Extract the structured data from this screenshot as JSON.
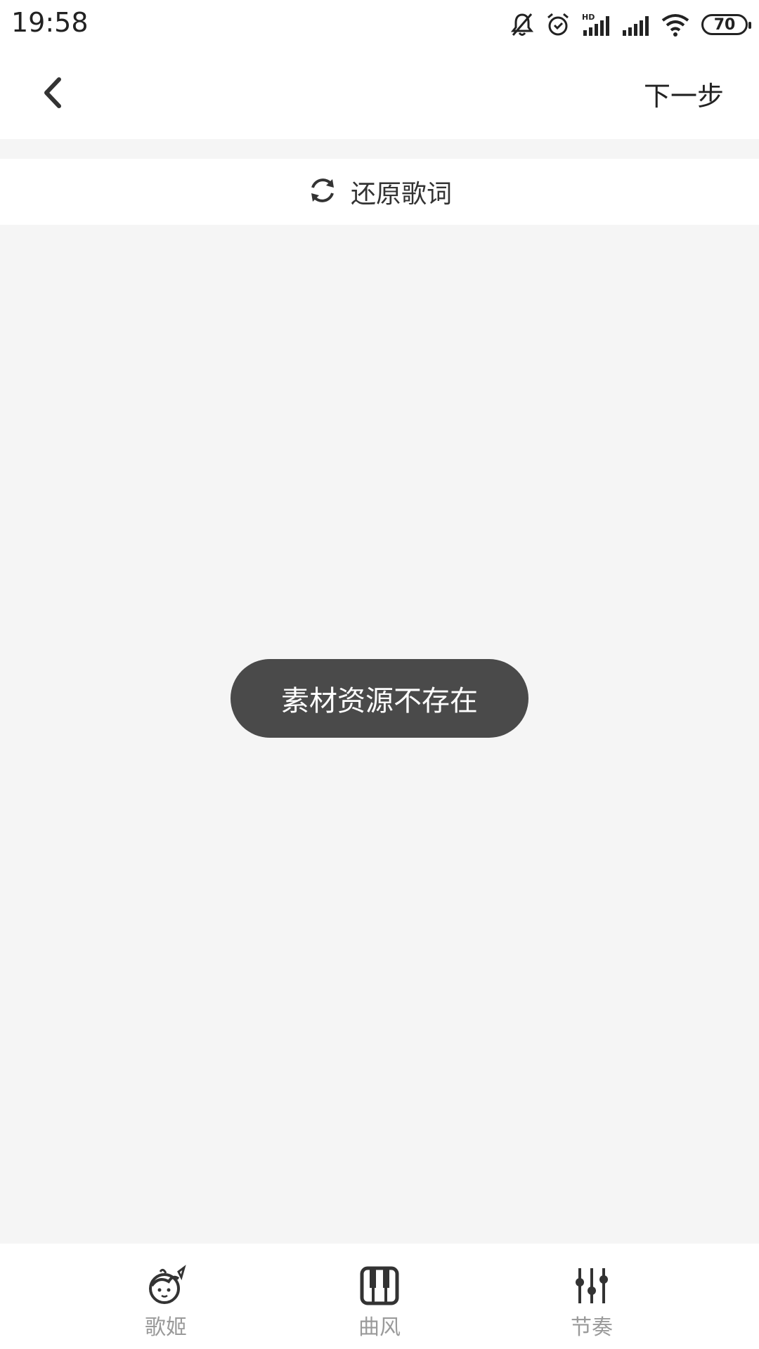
{
  "status_bar": {
    "time": "19:58",
    "battery": "70",
    "icons": [
      "bell-off-icon",
      "alarm-icon",
      "hd-signal-icon",
      "signal-icon",
      "wifi-icon",
      "battery-icon"
    ]
  },
  "nav": {
    "back_icon": "chevron-left-icon",
    "next_label": "下一步"
  },
  "restore": {
    "icon": "refresh-icon",
    "label": "还原歌词"
  },
  "toast": {
    "message": "素材资源不存在"
  },
  "tabs": [
    {
      "label": "歌姬",
      "icon": "singer-avatar-icon"
    },
    {
      "label": "曲风",
      "icon": "piano-icon"
    },
    {
      "label": "节奏",
      "icon": "equalizer-icon"
    }
  ]
}
